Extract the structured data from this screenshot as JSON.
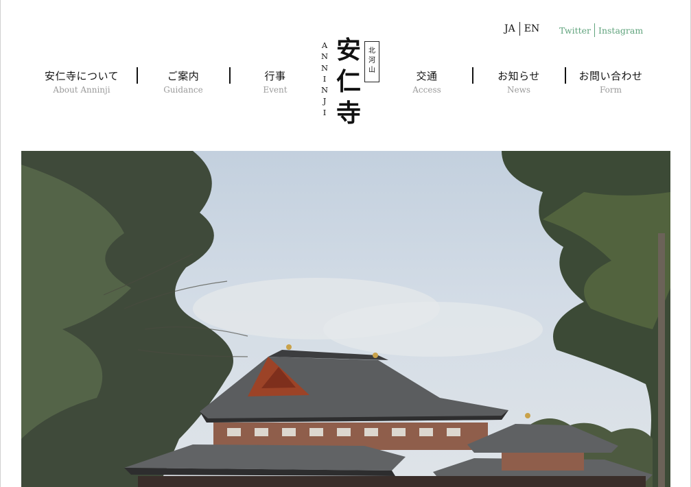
{
  "header": {
    "lang": {
      "ja": "JA",
      "en": "EN"
    },
    "social": {
      "twitter": "Twitter",
      "instagram": "Instagram"
    },
    "logo": {
      "roman": [
        "A",
        "N",
        "N",
        "I",
        "N",
        "J",
        "I"
      ],
      "kanji": [
        "安",
        "仁",
        "寺"
      ],
      "mountain": [
        "北",
        "河",
        "山"
      ]
    },
    "nav": [
      {
        "ja": "安仁寺について",
        "en": "About Anninji"
      },
      {
        "ja": "ご案内",
        "en": "Guidance"
      },
      {
        "ja": "行事",
        "en": "Event"
      },
      {
        "ja": "交通",
        "en": "Access"
      },
      {
        "ja": "お知らせ",
        "en": "News"
      },
      {
        "ja": "お問い合わせ",
        "en": "Form"
      }
    ]
  },
  "hero": {
    "icon": "temple-photo"
  },
  "colors": {
    "accent": "#5fa37c",
    "muted": "#9a9a9a",
    "text": "#111111"
  }
}
